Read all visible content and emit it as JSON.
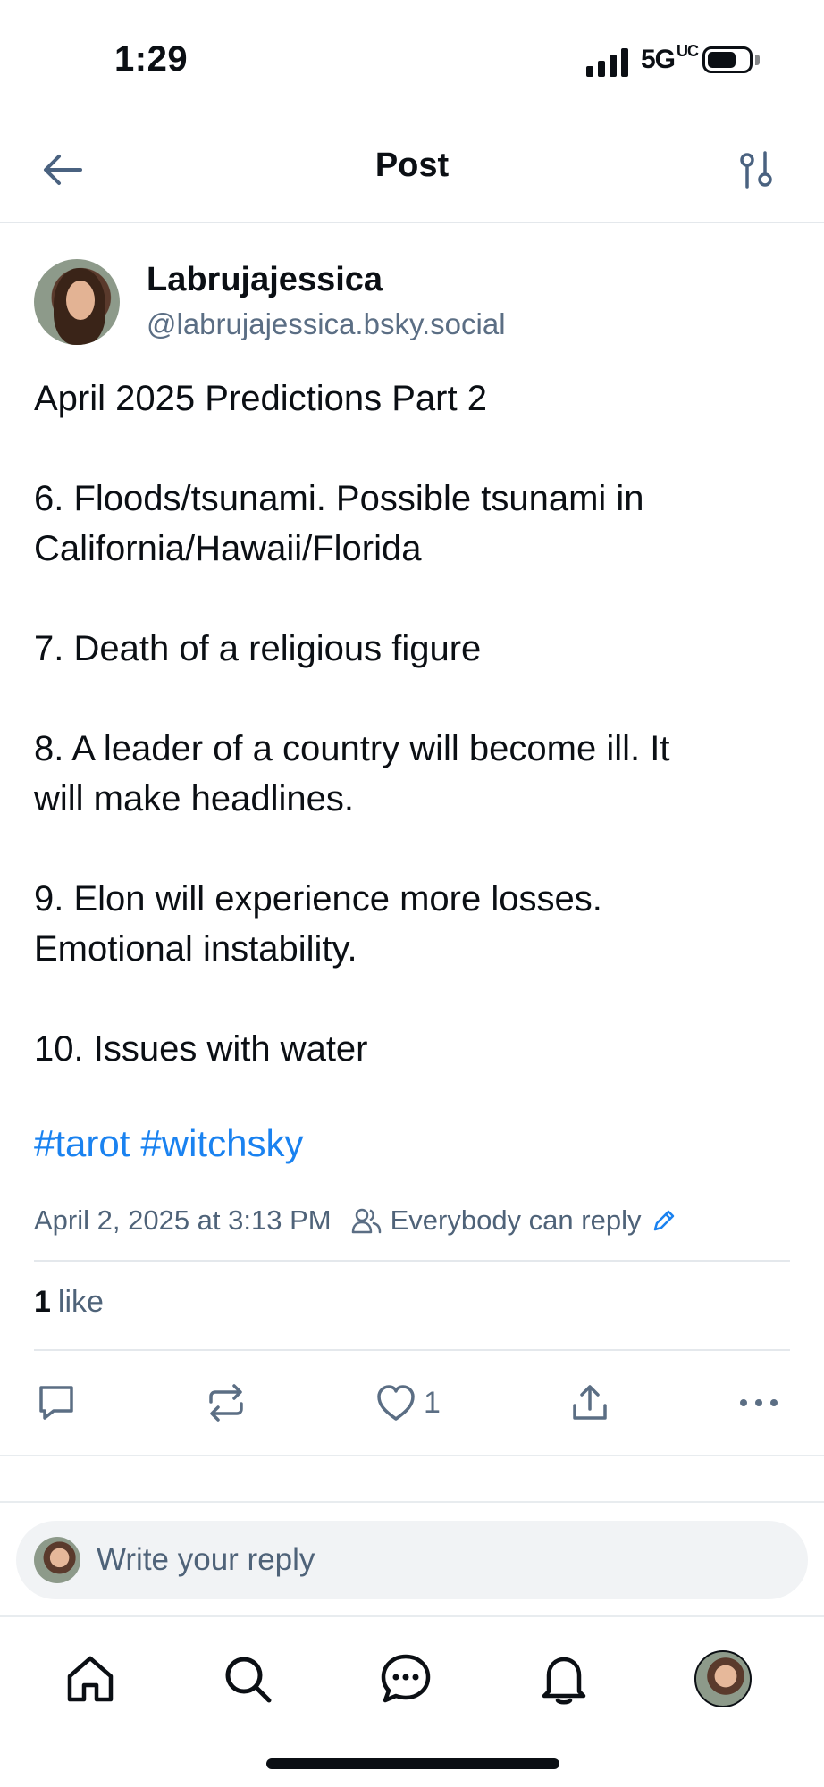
{
  "status_bar": {
    "time": "1:29",
    "network": "5G",
    "network_suffix": "UC"
  },
  "header": {
    "title": "Post"
  },
  "author": {
    "display_name": "Labrujajessica",
    "handle": "@labrujajessica.bsky.social"
  },
  "post": {
    "lines": [
      "April 2025 Predictions Part 2",
      "",
      "6. Floods/tsunami. Possible tsunami in",
      "California/Hawaii/Florida",
      "",
      "7. Death of a religious figure",
      "",
      "8. A leader of a country will become ill. It",
      "will make headlines.",
      "",
      "9. Elon will experience more losses.",
      "Emotional instability.",
      "",
      "10. Issues with water"
    ],
    "hashtags": [
      "#tarot",
      "#witchsky"
    ],
    "timestamp": "April 2, 2025 at 3:13 PM",
    "reply_setting": "Everybody can reply",
    "like_count_label": "1",
    "like_word": "like",
    "action_like_count": "1"
  },
  "reply": {
    "placeholder": "Write your reply"
  },
  "colors": {
    "link": "#1a82f0",
    "muted": "#4f6379",
    "text": "#0b0f14",
    "divider": "#e4e8ec"
  },
  "icons": {
    "back": "arrow-left-icon",
    "filter": "sliders-icon",
    "people": "people-icon",
    "edit": "pencil-icon",
    "reply": "speech-bubble-icon",
    "repost": "repost-icon",
    "like": "heart-icon",
    "share": "share-icon",
    "more": "more-dots-icon",
    "home": "home-icon",
    "search": "search-icon",
    "chat": "chat-icon",
    "notifications": "bell-icon"
  }
}
